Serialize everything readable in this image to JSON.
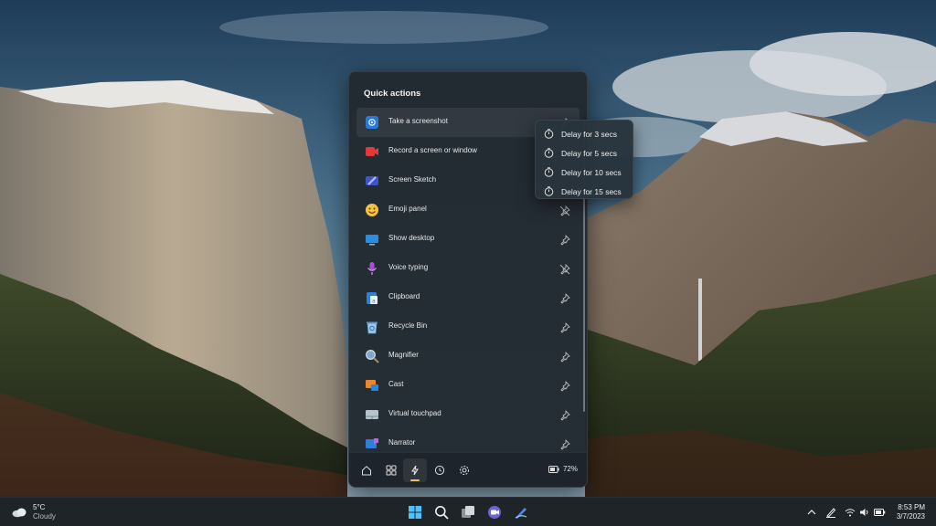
{
  "panel": {
    "title": "Quick actions",
    "actions": [
      {
        "label": "Take a screenshot",
        "icon": "screenshot-icon",
        "pin": "pinned"
      },
      {
        "label": "Record a screen or window",
        "icon": "record-icon",
        "pin": "pinned"
      },
      {
        "label": "Screen Sketch",
        "icon": "screen-sketch-icon",
        "pin": "pinned"
      },
      {
        "label": "Emoji panel",
        "icon": "emoji-icon",
        "pin": "unpin"
      },
      {
        "label": "Show desktop",
        "icon": "show-desktop-icon",
        "pin": "pinned"
      },
      {
        "label": "Voice typing",
        "icon": "microphone-icon",
        "pin": "unpin"
      },
      {
        "label": "Clipboard",
        "icon": "clipboard-icon",
        "pin": "pinned"
      },
      {
        "label": "Recycle Bin",
        "icon": "recycle-bin-icon",
        "pin": "pinned"
      },
      {
        "label": "Magnifier",
        "icon": "magnifier-icon",
        "pin": "pinned"
      },
      {
        "label": "Cast",
        "icon": "cast-icon",
        "pin": "pinned"
      },
      {
        "label": "Virtual touchpad",
        "icon": "touchpad-icon",
        "pin": "pinned"
      },
      {
        "label": "Narrator",
        "icon": "narrator-icon",
        "pin": "pinned"
      }
    ],
    "footer": {
      "tabs": [
        "home-icon",
        "widgets-icon",
        "quick-actions-icon",
        "history-icon",
        "settings-icon"
      ],
      "active_tab": "quick-actions-icon",
      "battery": "72%"
    }
  },
  "delay_menu": {
    "items": [
      "Delay for 3 secs",
      "Delay for 5 secs",
      "Delay for 10 secs",
      "Delay for 15 secs"
    ]
  },
  "taskbar": {
    "weather": {
      "temp": "5°C",
      "condition": "Cloudy"
    },
    "apps": [
      "windows-start-icon",
      "search-icon",
      "task-view-icon",
      "chat-icon",
      "pen-app-icon"
    ],
    "tray": [
      "chevron-up-icon",
      "pen-icon",
      "wifi-icon",
      "volume-icon",
      "battery-icon"
    ],
    "time": "8:53 PM",
    "date": "3/7/2023"
  },
  "colors": {
    "accent": "#e6c25a",
    "panel_bg": "#222a30"
  }
}
